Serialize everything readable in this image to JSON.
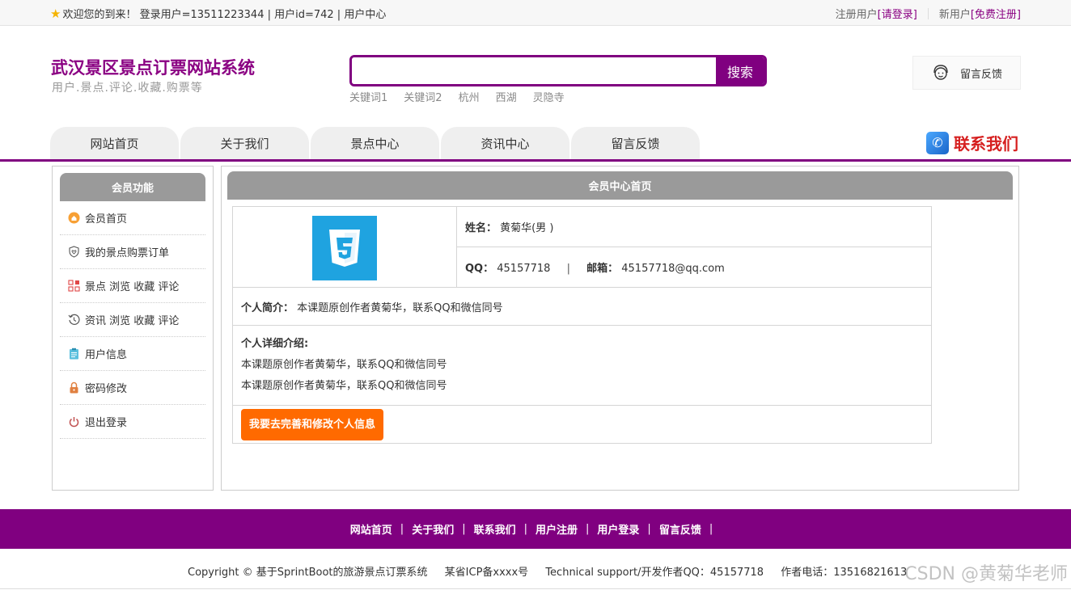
{
  "topbar": {
    "welcome": "欢迎您的到来！ 登录用户=13511223344 | 用户id=742 | 用户中心",
    "register_prefix": "注册用户",
    "login_link": "[请登录]",
    "new_user_prefix": "新用户",
    "signup_link": "[免费注册]"
  },
  "header": {
    "title": "武汉景区景点订票网站系统",
    "subtitle": "用户.景点.评论.收藏.购票等",
    "search_button": "搜索",
    "search_value": "",
    "keywords": [
      "关键词1",
      "关键词2",
      "杭州",
      "西湖",
      "灵隐寺"
    ],
    "feedback": "留言反馈"
  },
  "nav": {
    "tabs": [
      "网站首页",
      "关于我们",
      "景点中心",
      "资讯中心",
      "留言反馈"
    ],
    "contact": "联系我们"
  },
  "sidebar": {
    "title": "会员功能",
    "items": [
      {
        "label": "会员首页",
        "icon": "home-icon"
      },
      {
        "label": "我的景点购票订单",
        "icon": "shield-heart-icon"
      },
      {
        "label": "景点 浏览 收藏 评论",
        "icon": "grid-icon"
      },
      {
        "label": "资讯 浏览 收藏 评论",
        "icon": "history-icon"
      },
      {
        "label": "用户信息",
        "icon": "clipboard-icon"
      },
      {
        "label": "密码修改",
        "icon": "lock-icon"
      },
      {
        "label": "退出登录",
        "icon": "power-icon"
      }
    ]
  },
  "main": {
    "title": "会员中心首页",
    "name_label": "姓名：",
    "name_value": "黄菊华(男 )",
    "qq_label": "QQ：",
    "qq_value": "45157718",
    "divider": "|",
    "email_label": "邮箱：",
    "email_value": "45157718@qq.com",
    "intro_label": "个人简介：",
    "intro_value": "本课题原创作者黄菊华，联系QQ和微信同号",
    "detail_label": "个人详细介绍:",
    "detail_lines": [
      "本课题原创作者黄菊华，联系QQ和微信同号",
      "本课题原创作者黄菊华，联系QQ和微信同号"
    ],
    "edit_button": "我要去完善和修改个人信息"
  },
  "footer": {
    "links": [
      "网站首页",
      "关于我们",
      "联系我们",
      "用户注册",
      "用户登录",
      "留言反馈"
    ],
    "pipe": "|",
    "copyright": "Copyright © 基于SprintBoot的旅游景点订票系统",
    "icp": "某省ICP备xxxx号",
    "support": "Technical support/开发作者QQ：45157718",
    "phone": "作者电话：13516821613",
    "watermark": "CSDN @黄菊华老师"
  },
  "colors": {
    "brand": "#800080",
    "accent_orange": "#ff6a00",
    "header_gray": "#9a9a9a",
    "contact_red": "#d62020"
  }
}
